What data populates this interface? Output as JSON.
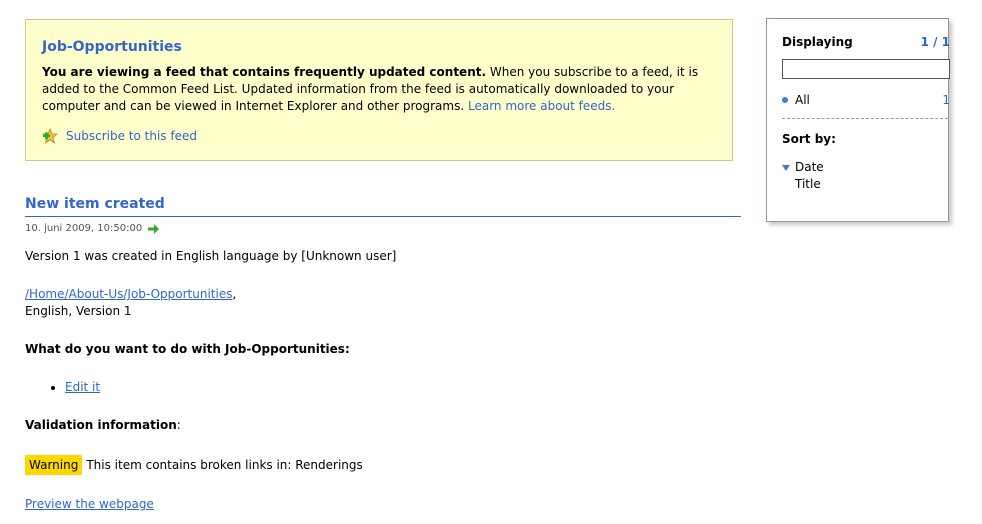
{
  "feed": {
    "title": "Job-Opportunities",
    "desc_bold": "You are viewing a feed that contains frequently updated content.",
    "desc_text": " When you subscribe to a feed, it is added to the Common Feed List. Updated information from the feed is automatically downloaded to your computer and can be viewed in Internet Explorer and other programs. ",
    "learn_more": "Learn more about feeds.",
    "subscribe": "Subscribe to this feed"
  },
  "sidebar": {
    "displaying_label": "Displaying",
    "displaying_count": "1 / 1",
    "filter_value": "",
    "all_label": "All",
    "all_count": "1",
    "sort_label": "Sort by:",
    "sort_options": [
      "Date",
      "Title"
    ]
  },
  "item": {
    "title": "New item created",
    "date": "10. juni 2009, 10:50:00",
    "version_text": "Version 1 was created in English language by [Unknown user]",
    "path_link": "/Home/About-Us/Job-Opportunities",
    "path_suffix": ",",
    "language_version": "English, Version 1",
    "question": "What do you want to do with Job-Opportunities:",
    "actions": [
      "Edit it"
    ],
    "validation_label": "Validation information",
    "validation_colon": ":",
    "warning_badge": "Warning",
    "warning_text": "This item contains broken links in: Renderings",
    "preview_link": "Preview the webpage"
  },
  "colors": {
    "accent": "#3366cc",
    "feed_background": "#ffffcc",
    "warning": "#ffd700",
    "arrow": "#33aa33"
  }
}
